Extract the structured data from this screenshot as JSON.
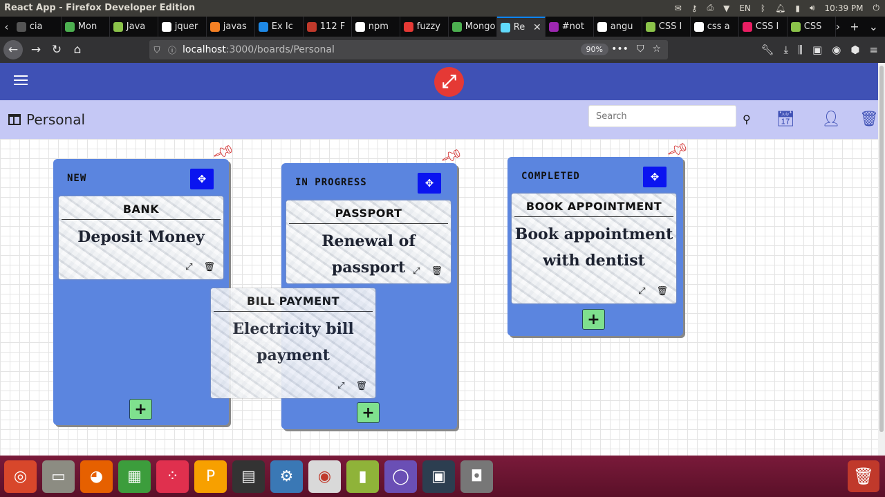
{
  "os": {
    "window_title": "React App - Firefox Developer Edition",
    "lang": "EN",
    "time": "10:39 PM"
  },
  "browser": {
    "tabs": [
      {
        "label": "cia",
        "color": "#555555"
      },
      {
        "label": "Mon",
        "color": "#4caf50"
      },
      {
        "label": "Java",
        "color": "#8bc34a"
      },
      {
        "label": "jquer",
        "color": "#ffffff"
      },
      {
        "label": "javas",
        "color": "#f48024"
      },
      {
        "label": "Ex Ic",
        "color": "#1e88e5"
      },
      {
        "label": "112 F",
        "color": "#c0392b"
      },
      {
        "label": "npm",
        "color": "#ffffff"
      },
      {
        "label": "fuzzy",
        "color": "#e53935"
      },
      {
        "label": "Mongo",
        "color": "#4caf50"
      },
      {
        "label": "Re",
        "color": "#61dafb",
        "active": true,
        "close": "✕"
      },
      {
        "label": "#not",
        "color": "#9c27b0"
      },
      {
        "label": "angu",
        "color": "#ffffff"
      },
      {
        "label": "CSS I",
        "color": "#8bc34a"
      },
      {
        "label": "css a",
        "color": "#ffffff"
      },
      {
        "label": "CSS I",
        "color": "#e91e63"
      },
      {
        "label": "CSS",
        "color": "#8bc34a"
      }
    ],
    "url_host": "localhost",
    "url_path": ":3000/boards/Personal",
    "zoom": "90%"
  },
  "app": {
    "board": {
      "title": "Personal",
      "search_placeholder": "Search"
    },
    "columns": [
      {
        "title": "NEW",
        "cards": [
          {
            "title": "BANK",
            "body": "Deposit Money"
          }
        ]
      },
      {
        "title": "IN PROGRESS",
        "cards": [
          {
            "title": "PASSPORT",
            "body": "Renewal of passport"
          }
        ]
      },
      {
        "title": "COMPLETED",
        "cards": [
          {
            "title": "BOOK APPOINTMENT",
            "body": "Book appointment with dentist"
          }
        ]
      }
    ],
    "dragging_card": {
      "title": "BILL PAYMENT",
      "body": "Electricity bill payment"
    },
    "colors": {
      "header": "#3f51b5",
      "board_bar": "#c5c8f5",
      "column": "#5b85df",
      "move_button": "#0a14f0",
      "add_button": "#7fe08e",
      "logo": "#e53935"
    }
  }
}
